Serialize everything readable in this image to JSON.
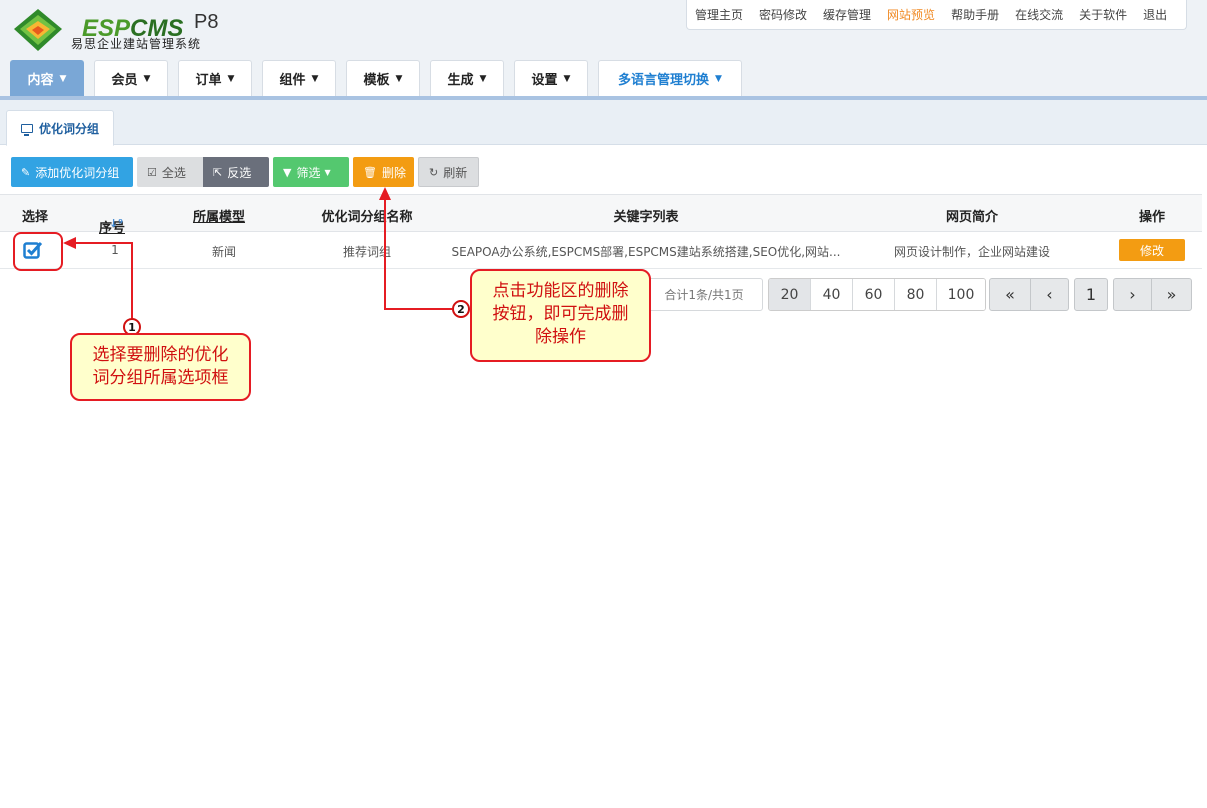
{
  "brand": {
    "name_en_part1": "ESP",
    "name_en_part2": "CMS",
    "version": "P8",
    "name_cn": "易思企业建站管理系统"
  },
  "top_links": [
    "管理主页",
    "密码修改",
    "缓存管理",
    "网站预览",
    "帮助手册",
    "在线交流",
    "关于软件",
    "退出"
  ],
  "main_nav": [
    "内容",
    "会员",
    "订单",
    "组件",
    "模板",
    "生成",
    "设置",
    "多语言管理切换"
  ],
  "sub_tab": "优化词分组",
  "toolbar": {
    "add": "添加优化词分组",
    "select_all": "全选",
    "invert": "反选",
    "filter": "筛选",
    "delete": "删除",
    "refresh": "刷新"
  },
  "table": {
    "headers": [
      "选择",
      "序号",
      "所属模型",
      "优化词分组名称",
      "关键字列表",
      "网页简介",
      "操作"
    ],
    "rows": [
      {
        "id": "1",
        "model": "新闻",
        "name": "推荐词组",
        "keywords": "SEAPOA办公系统,ESPCMS部署,ESPCMS建站系统搭建,SEO优化,网站...",
        "intro": "网页设计制作，企业网站建设",
        "action": "修改"
      }
    ]
  },
  "pagination": {
    "info": "合计1条/共1页",
    "page_sizes": [
      "20",
      "40",
      "60",
      "80",
      "100"
    ],
    "current_size": "20",
    "first": "«",
    "prev": "‹",
    "current_page": "1",
    "next": "›",
    "last": "»"
  },
  "annotations": {
    "step1_number": "1",
    "step1_line1": "选择要删除的优化",
    "step1_line2": "词分组所属选项框",
    "step2_number": "2",
    "step2_line1": "点击功能区的删除",
    "step2_line2": "按钮，即可完成删",
    "step2_line3": "除操作"
  },
  "colors": {
    "accent_blue": "#32a3e3",
    "delete_orange": "#f39c12",
    "filter_green": "#54c86f",
    "annotation_red": "#e51c23",
    "callout_bg": "#ffffcc"
  }
}
